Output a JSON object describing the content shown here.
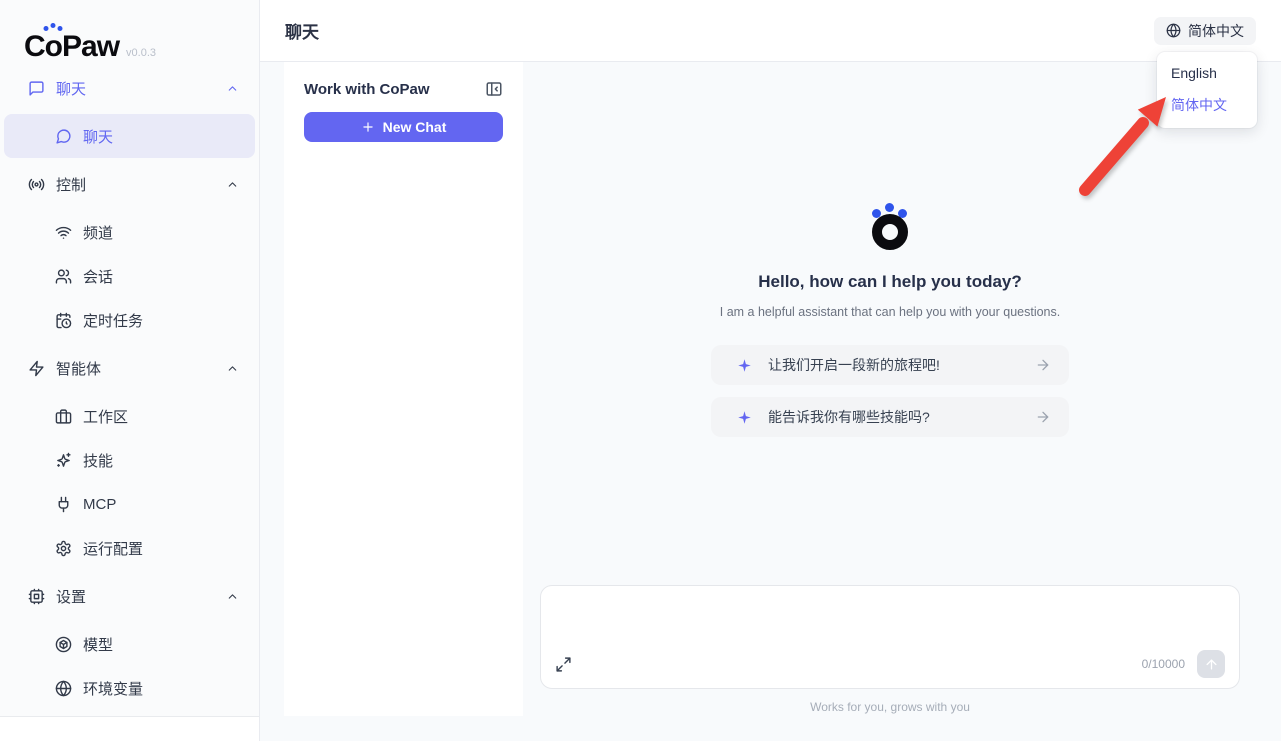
{
  "app": {
    "logo_parts": [
      "C",
      "o",
      "Paw"
    ],
    "version": "v0.0.3"
  },
  "header": {
    "title": "聊天",
    "language_button_label": "简体中文"
  },
  "language_menu": {
    "items": [
      {
        "label": "English",
        "active": false
      },
      {
        "label": "简体中文",
        "active": true
      }
    ]
  },
  "sidebar": {
    "sections": [
      {
        "label": "聊天",
        "icon": "message-square-icon",
        "active": true,
        "items": [
          {
            "label": "聊天",
            "icon": "message-circle-icon",
            "selected": true
          }
        ]
      },
      {
        "label": "控制",
        "icon": "radio-icon",
        "active": false,
        "items": [
          {
            "label": "频道",
            "icon": "wifi-icon"
          },
          {
            "label": "会话",
            "icon": "users-icon"
          },
          {
            "label": "定时任务",
            "icon": "calendar-clock-icon"
          }
        ]
      },
      {
        "label": "智能体",
        "icon": "zap-icon",
        "active": false,
        "items": [
          {
            "label": "工作区",
            "icon": "briefcase-icon"
          },
          {
            "label": "技能",
            "icon": "sparkles-icon"
          },
          {
            "label": "MCP",
            "icon": "plug-icon"
          },
          {
            "label": "运行配置",
            "icon": "gear-icon"
          }
        ]
      },
      {
        "label": "设置",
        "icon": "cpu-icon",
        "active": false,
        "items": [
          {
            "label": "模型",
            "icon": "cube-icon"
          },
          {
            "label": "环境变量",
            "icon": "globe-icon"
          }
        ]
      }
    ]
  },
  "chat_panel": {
    "title": "Work with CoPaw",
    "new_chat_label": "New Chat"
  },
  "chat": {
    "greeting_title": "Hello, how can I help you today?",
    "greeting_subtitle": "I am a helpful assistant that can help you with your questions.",
    "suggestions": [
      {
        "label": "让我们开启一段新的旅程吧!"
      },
      {
        "label": "能告诉我你有哪些技能吗?"
      }
    ],
    "input": {
      "value": "",
      "placeholder": "",
      "counter": "0/10000"
    },
    "footer": "Works for you, grows with you"
  },
  "colors": {
    "accent_indigo": "#6366f1",
    "logo_dot_blue": "#2f54eb",
    "selected_item_bg": "#e9eaf8",
    "main_background": "#f8fafc",
    "chip_background": "#f3f4f6",
    "annotation_arrow_red": "#ee4237",
    "send_button_disabled": "#dde0e6"
  }
}
